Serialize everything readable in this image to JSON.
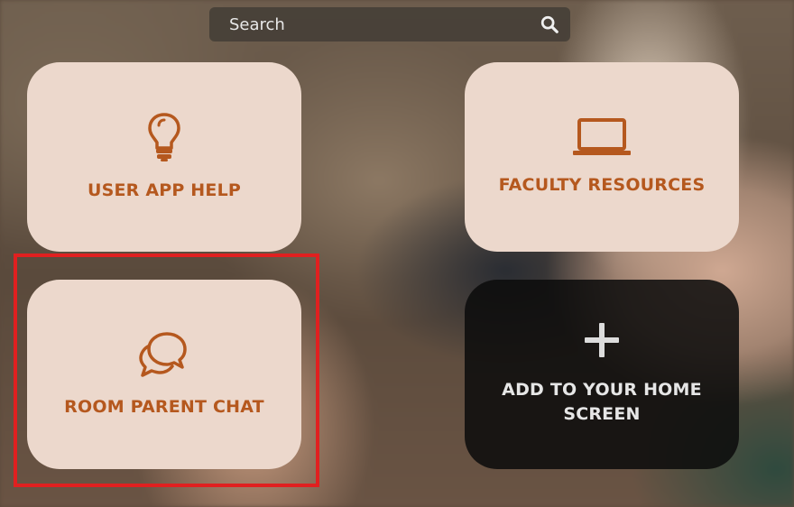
{
  "search": {
    "placeholder": "Search",
    "icon": "search-icon"
  },
  "tiles": [
    {
      "label": "USER APP HELP",
      "icon": "lightbulb-icon"
    },
    {
      "label": "FACULTY RESOURCES",
      "icon": "laptop-icon"
    },
    {
      "label": "ROOM PARENT CHAT",
      "icon": "chat-bubbles-icon"
    },
    {
      "label": "ADD TO YOUR HOME SCREEN",
      "icon": "plus-icon"
    }
  ],
  "colors": {
    "tile_background": "#ecd8cc",
    "tile_accent": "#b5581e",
    "dark_tile_background": "#0c0c0c",
    "highlight_border": "#e02020"
  }
}
